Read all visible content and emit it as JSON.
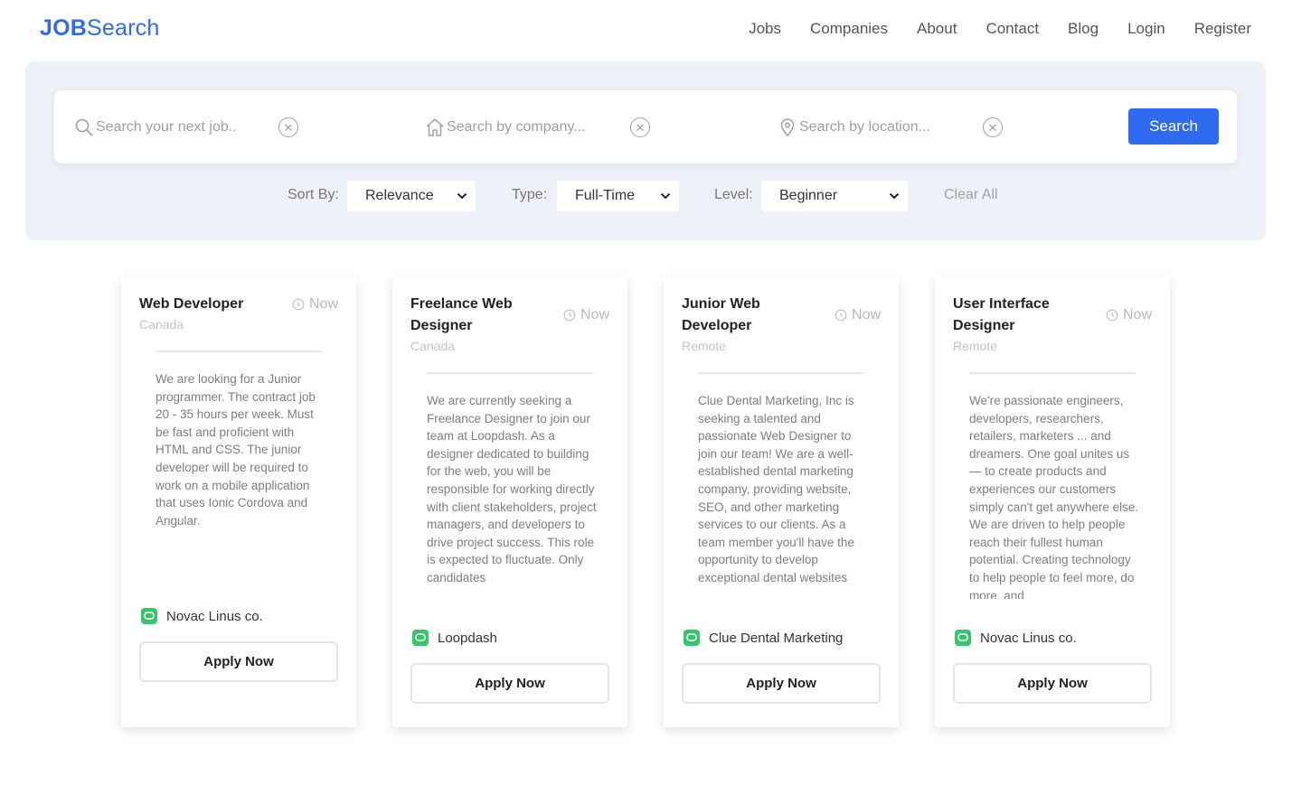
{
  "brand": {
    "bold": "JOB",
    "light": "Search",
    "color": "#2f6bf0"
  },
  "nav": [
    "Jobs",
    "Companies",
    "About",
    "Contact",
    "Blog",
    "Login",
    "Register"
  ],
  "search": {
    "job_placeholder": "Search your next job..",
    "company_placeholder": "Search by company...",
    "location_placeholder": "Search by location...",
    "button_label": "Search"
  },
  "filters": {
    "sort_label": "Sort By:",
    "sort_value": "Relevance",
    "type_label": "Type:",
    "type_value": "Full-Time",
    "level_label": "Level:",
    "level_value": "Beginner",
    "clear_all": "Clear All"
  },
  "cards": [
    {
      "title": "Web Developer",
      "time": "Now",
      "location": "Canada",
      "description": "We are looking for a Junior programmer. The contract job 20 - 35 hours per week. Must be fast and proficient with HTML and CSS. The junior developer will be required to work on a mobile application that uses Ionic Cordova and Angular.",
      "company": "Novac Linus co.",
      "apply": "Apply Now"
    },
    {
      "title": "Freelance Web Designer",
      "time": "Now",
      "location": "Canada",
      "description": "We are currently seeking a Freelance Designer to join our team at Loopdash. As a designer dedicated to building for the web, you will be responsible for working directly with client stakeholders, project managers, and developers to drive project success. This role is expected to fluctuate. Only candidates",
      "company": "Loopdash",
      "apply": "Apply Now"
    },
    {
      "title": "Junior Web Developer",
      "time": "Now",
      "location": "Remote",
      "description": "Clue Dental Marketing, Inc is seeking a talented and passionate Web Designer to join our team! We are a well-established dental marketing company, providing website, SEO, and other marketing services to our clients. As a team member you'll have the opportunity to develop exceptional dental websites",
      "company": "Clue Dental Marketing",
      "apply": "Apply Now"
    },
    {
      "title": "User Interface Designer",
      "time": "Now",
      "location": "Remote",
      "description": "We're passionate engineers, developers, researchers, retailers, marketers ... and dreamers. One goal unites us — to create products and experiences our customers simply can't get anywhere else. We are driven to help people reach their fullest human potential. Creating technology to help people to feel more, do more, and",
      "company": "Novac Linus co.",
      "apply": "Apply Now"
    }
  ]
}
